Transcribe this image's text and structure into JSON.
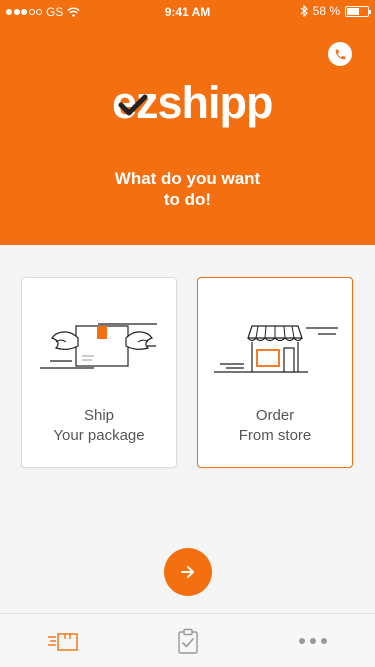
{
  "status_bar": {
    "carrier": "GS",
    "time": "9:41 AM",
    "battery_label": "58 %",
    "battery_level": 0.58
  },
  "header": {
    "logo_text": "ezshipp",
    "prompt_line1": "What do you want",
    "prompt_line2": "to do!"
  },
  "options": [
    {
      "line1": "Ship",
      "line2": "Your package",
      "icon": "winged-package-icon",
      "selected": false
    },
    {
      "line1": "Order",
      "line2": "From store",
      "icon": "store-icon",
      "selected": true
    }
  ],
  "tab_bar": {
    "items": [
      {
        "icon": "delivery-tab-icon",
        "active": true
      },
      {
        "icon": "clipboard-tab-icon",
        "active": false
      },
      {
        "icon": "more-dots-icon",
        "active": false
      }
    ]
  },
  "colors": {
    "brand": "#f36f10",
    "background": "#f5f5f5",
    "card_text": "#555555",
    "inactive_icon": "#999999"
  }
}
